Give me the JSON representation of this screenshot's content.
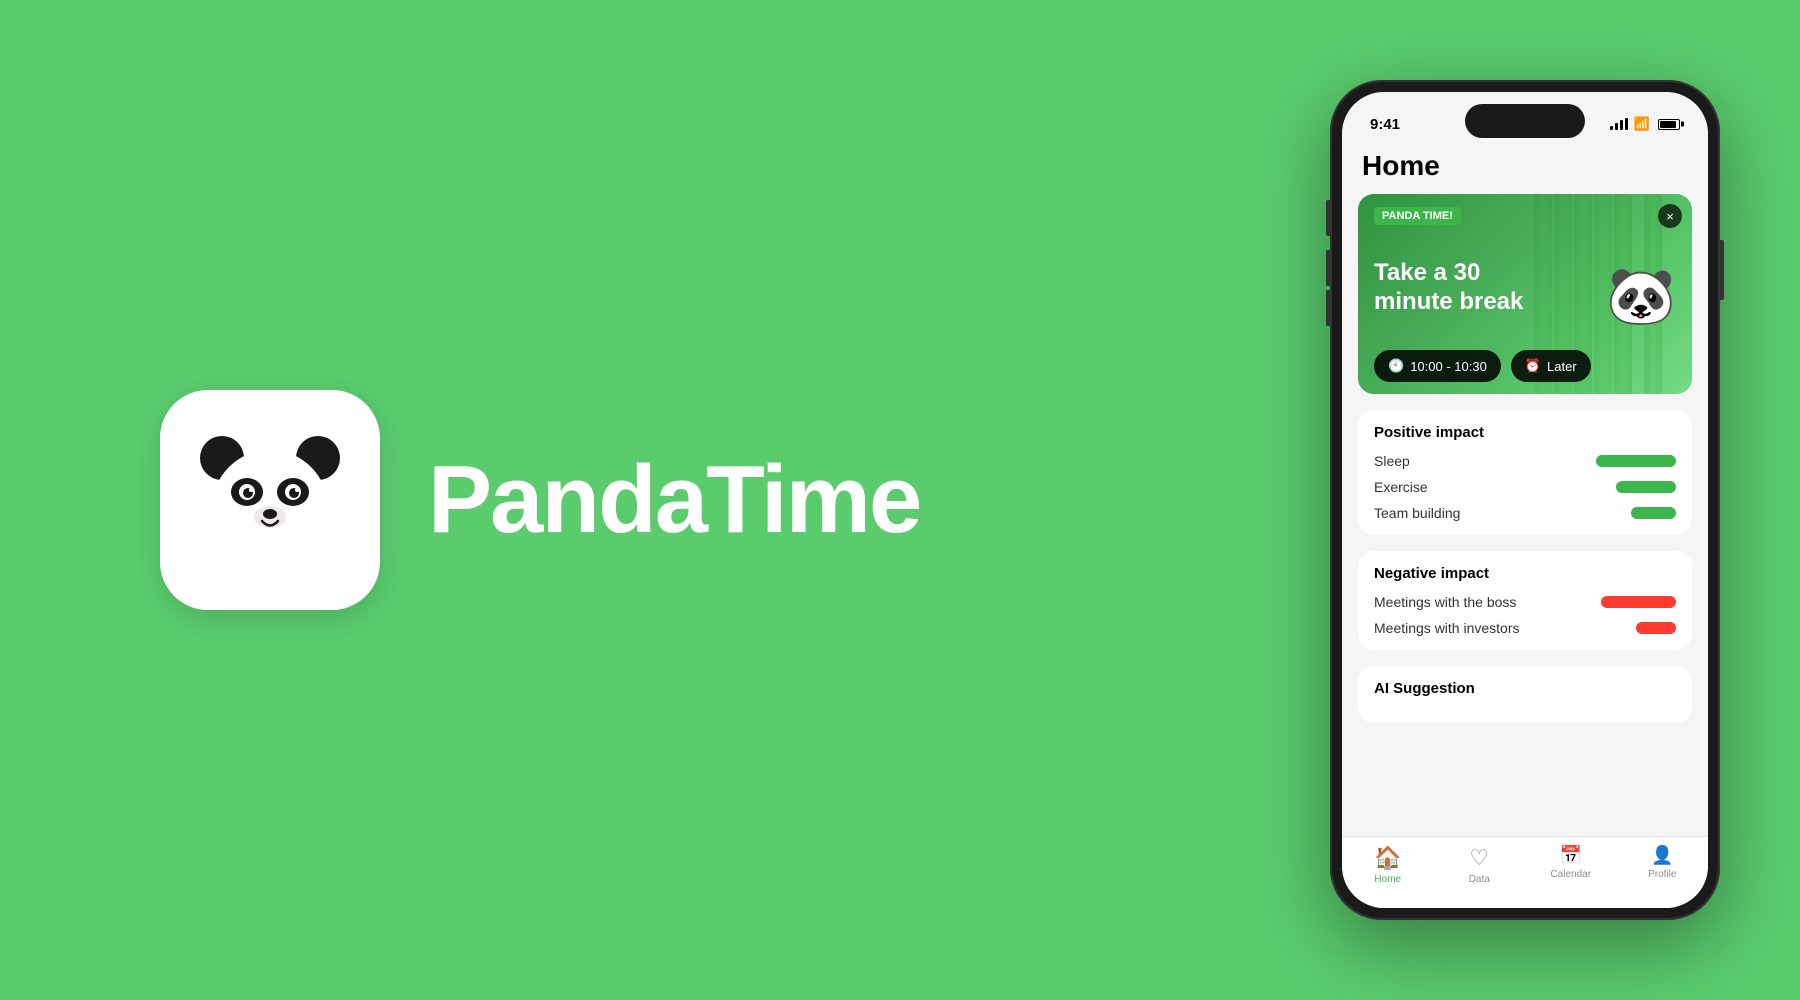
{
  "background_color": "#5acc6e",
  "app": {
    "name": "PandaTime"
  },
  "phone": {
    "status_bar": {
      "time": "9:41",
      "signal_label": "signal",
      "wifi_label": "wifi",
      "battery_label": "battery"
    },
    "page_title": "Home",
    "banner": {
      "tag": "PANDA TIME!",
      "headline": "Take a 30 minute break",
      "time_button": "10:00 - 10:30",
      "later_button": "Later",
      "close_label": "×"
    },
    "positive_impact": {
      "title": "Positive impact",
      "items": [
        {
          "label": "Sleep",
          "bar_size": "long"
        },
        {
          "label": "Exercise",
          "bar_size": "medium"
        },
        {
          "label": "Team building",
          "bar_size": "short"
        }
      ]
    },
    "negative_impact": {
      "title": "Negative impact",
      "items": [
        {
          "label": "Meetings with the boss",
          "bar_size": "long"
        },
        {
          "label": "Meetings with investors",
          "bar_size": "short"
        }
      ]
    },
    "ai_section": {
      "title": "AI Suggestion"
    },
    "bottom_nav": {
      "items": [
        {
          "label": "Home",
          "icon": "🏠",
          "active": true
        },
        {
          "label": "Data",
          "icon": "♡",
          "active": false
        },
        {
          "label": "Calendar",
          "icon": "📅",
          "active": false
        },
        {
          "label": "Profile",
          "icon": "👤",
          "active": false
        }
      ]
    }
  }
}
